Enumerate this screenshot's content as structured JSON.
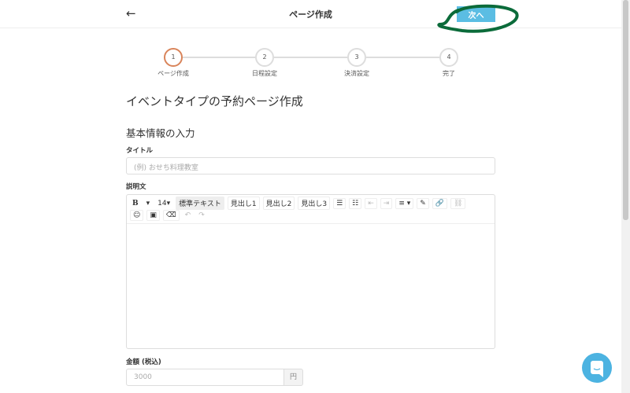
{
  "header": {
    "back_icon": "arrow-left-icon",
    "title": "ページ作成",
    "next_label": "次へ",
    "annotation_color": "#0b6b3a",
    "accent": "#5bbde3"
  },
  "steps": [
    {
      "num": "1",
      "label": "ページ作成"
    },
    {
      "num": "2",
      "label": "日程設定"
    },
    {
      "num": "3",
      "label": "決済設定"
    },
    {
      "num": "4",
      "label": "完了"
    }
  ],
  "main": {
    "heading": "イベントタイプの予約ページ作成",
    "section": "基本情報の入力",
    "title_label": "タイトル",
    "title_placeholder": "(例) おせち料理教室",
    "desc_label": "説明文",
    "toolbar": {
      "bold": "B",
      "caret": "▾",
      "size": "14▾",
      "normal": "標準テキスト",
      "h1": "見出し1",
      "h2": "見出し2",
      "h3": "見出し3",
      "ul": "☰",
      "ol": "☷",
      "outdent": "⇤",
      "indent": "⇥",
      "align": "≡ ▾",
      "color": "✎",
      "link": "🔗",
      "unlink": "⛓",
      "emoji": "☺",
      "image": "▣",
      "eraser": "⌫",
      "undo": "↶",
      "redo": "↷"
    },
    "price_label": "金額 (税込)",
    "price_placeholder": "3000",
    "price_unit": "円"
  }
}
